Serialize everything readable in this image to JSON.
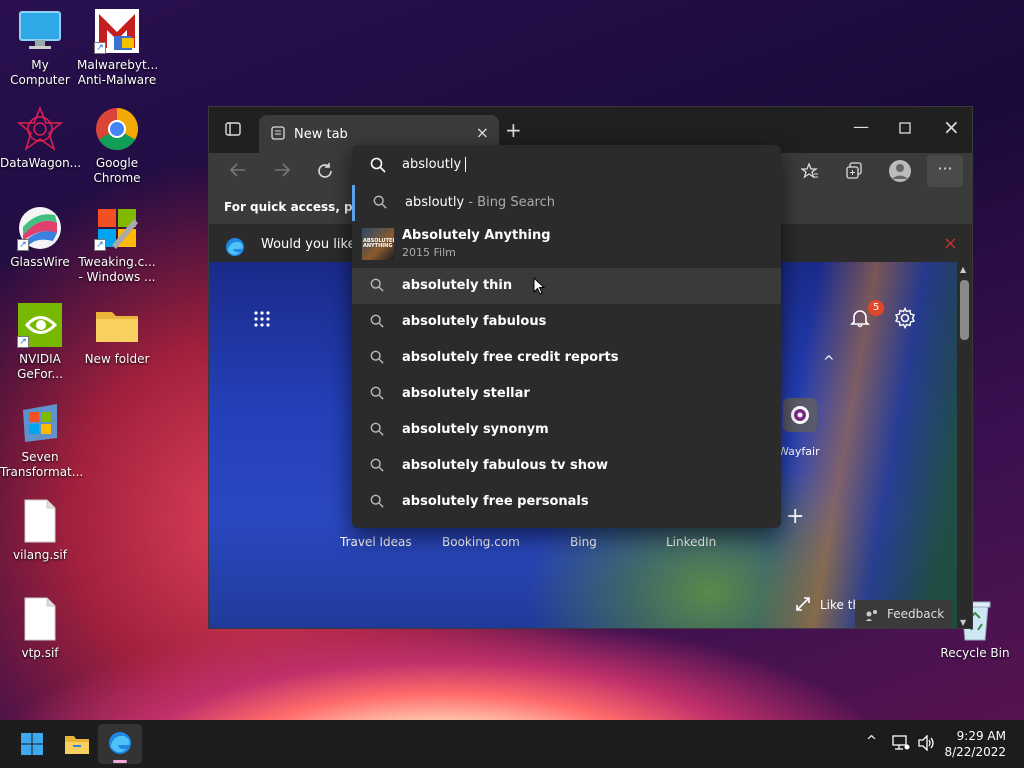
{
  "desktop": {
    "icons": [
      {
        "label": "My Computer"
      },
      {
        "label": "Malwarebyt... Anti-Malware"
      },
      {
        "label": "DataWagon..."
      },
      {
        "label": "Google Chrome"
      },
      {
        "label": "GlassWire"
      },
      {
        "label": "Tweaking.c... - Windows ..."
      },
      {
        "label": "NVIDIA GeFor..."
      },
      {
        "label": "New folder"
      },
      {
        "label": "Seven Transformat..."
      },
      {
        "label": "vilang.sif"
      },
      {
        "label": "vtp.sif"
      },
      {
        "label": "Recycle Bin"
      }
    ]
  },
  "browser": {
    "tab_title": "New tab",
    "address_value": "absloutly",
    "favorites_hint": "For quick access, place y",
    "info_prompt": "Would you like t",
    "notification_count": "5",
    "quick_links": [
      "Travel Ideas",
      "Booking.com",
      "Bing",
      "LinkedIn"
    ],
    "wayfair_label": "Wayfair",
    "like_text": "Like th",
    "feedback_label": "Feedback"
  },
  "suggestions": {
    "first": {
      "text": "absloutly",
      "suffix": "- Bing Search"
    },
    "entity": {
      "title": "Absolutely Anything",
      "subtitle": "2015 Film",
      "poster_text": "ABSOLUTELY ANYTHING"
    },
    "items": [
      "absolutely thin",
      "absolutely fabulous",
      "absolutely free credit reports",
      "absolutely stellar",
      "absolutely synonym",
      "absolutely fabulous tv show",
      "absolutely free personals"
    ]
  },
  "taskbar": {
    "time": "9:29 AM",
    "date": "8/22/2022"
  },
  "colors": {
    "accent": "#5aa0e8",
    "badge": "#e2462b"
  }
}
